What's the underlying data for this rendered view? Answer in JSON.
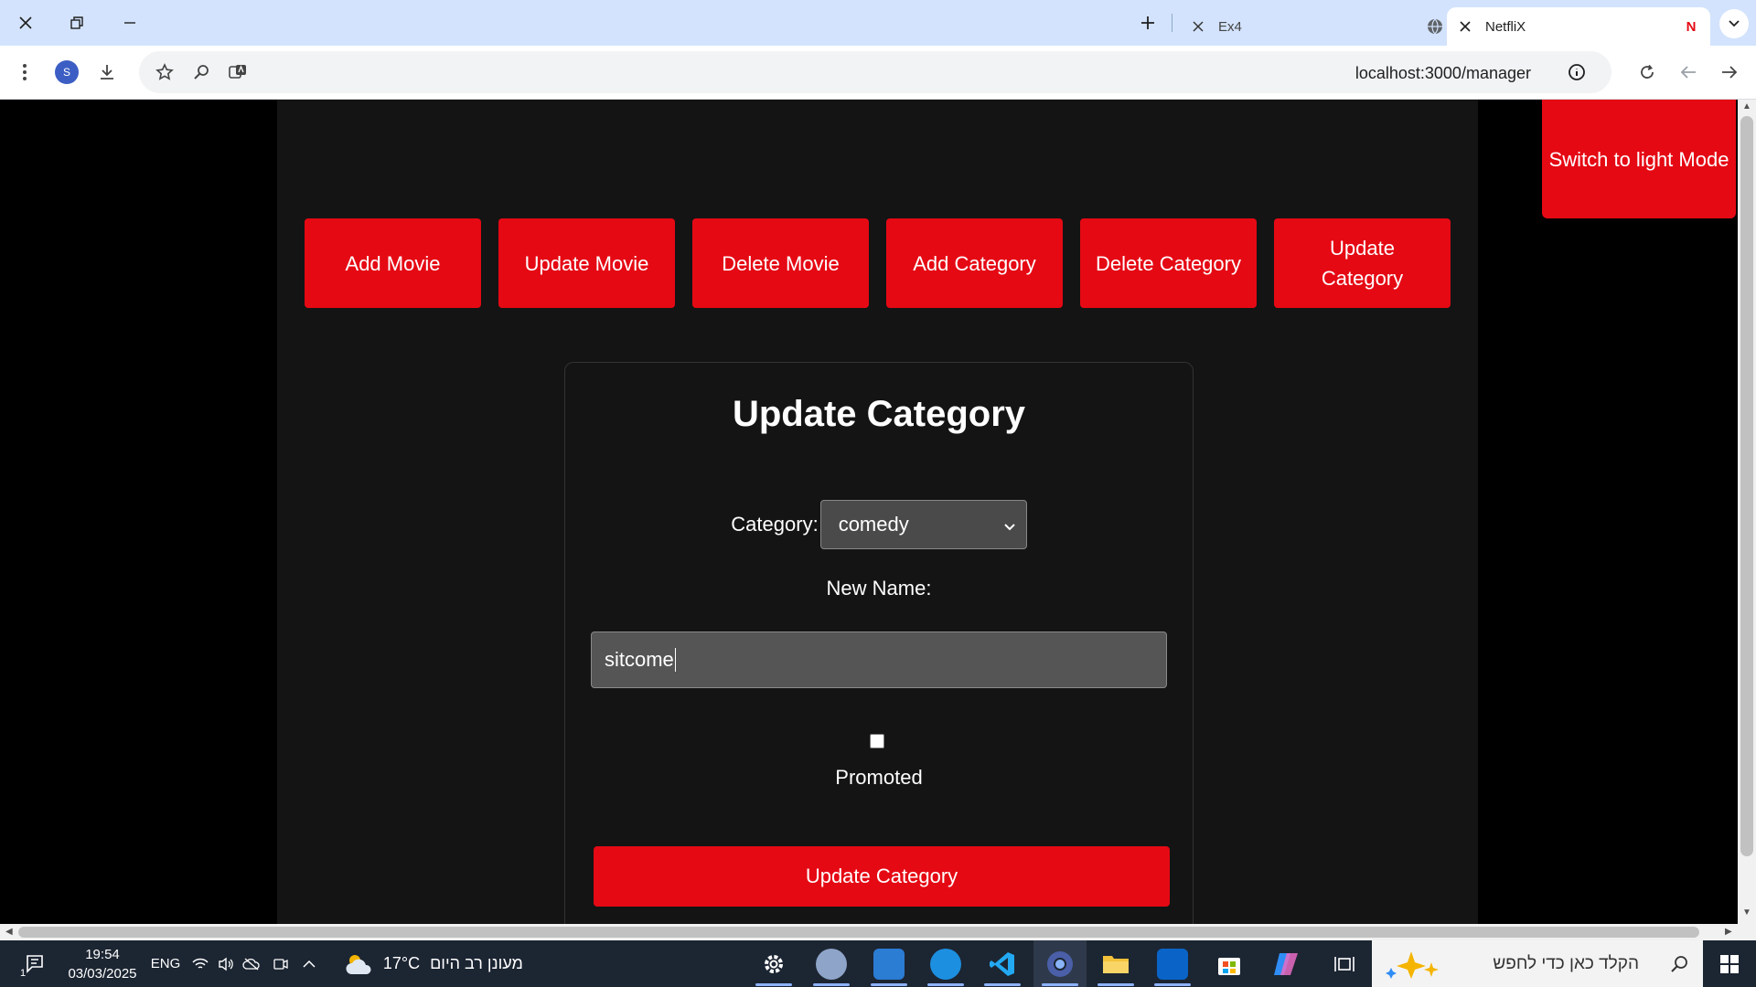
{
  "browser": {
    "tabs": [
      {
        "title": "Ex4"
      },
      {
        "title": "NetfliX",
        "favicon": "N"
      }
    ],
    "url": "localhost:3000/manager",
    "profile_initial": "S"
  },
  "page": {
    "mode_toggle": "Switch to light Mode",
    "nav": {
      "add_movie": "Add Movie",
      "update_movie": "Update Movie",
      "delete_movie": "Delete Movie",
      "add_category": "Add Category",
      "delete_category": "Delete Category",
      "update_category": "Update Category"
    },
    "form": {
      "title": "Update Category",
      "category_label": "Category:",
      "category_selected": "comedy",
      "new_name_label": "New Name:",
      "new_name_value": "sitcome",
      "promoted_label": "Promoted",
      "promoted_checked": false,
      "submit": "Update Category"
    },
    "accent_color": "#e50914"
  },
  "taskbar": {
    "time": "19:54",
    "date": "03/03/2025",
    "language": "ENG",
    "temperature": "17°C",
    "weather": "מעונן רב היום",
    "search_placeholder": "הקלד כאן כדי לחפש",
    "notification_count": "1"
  }
}
